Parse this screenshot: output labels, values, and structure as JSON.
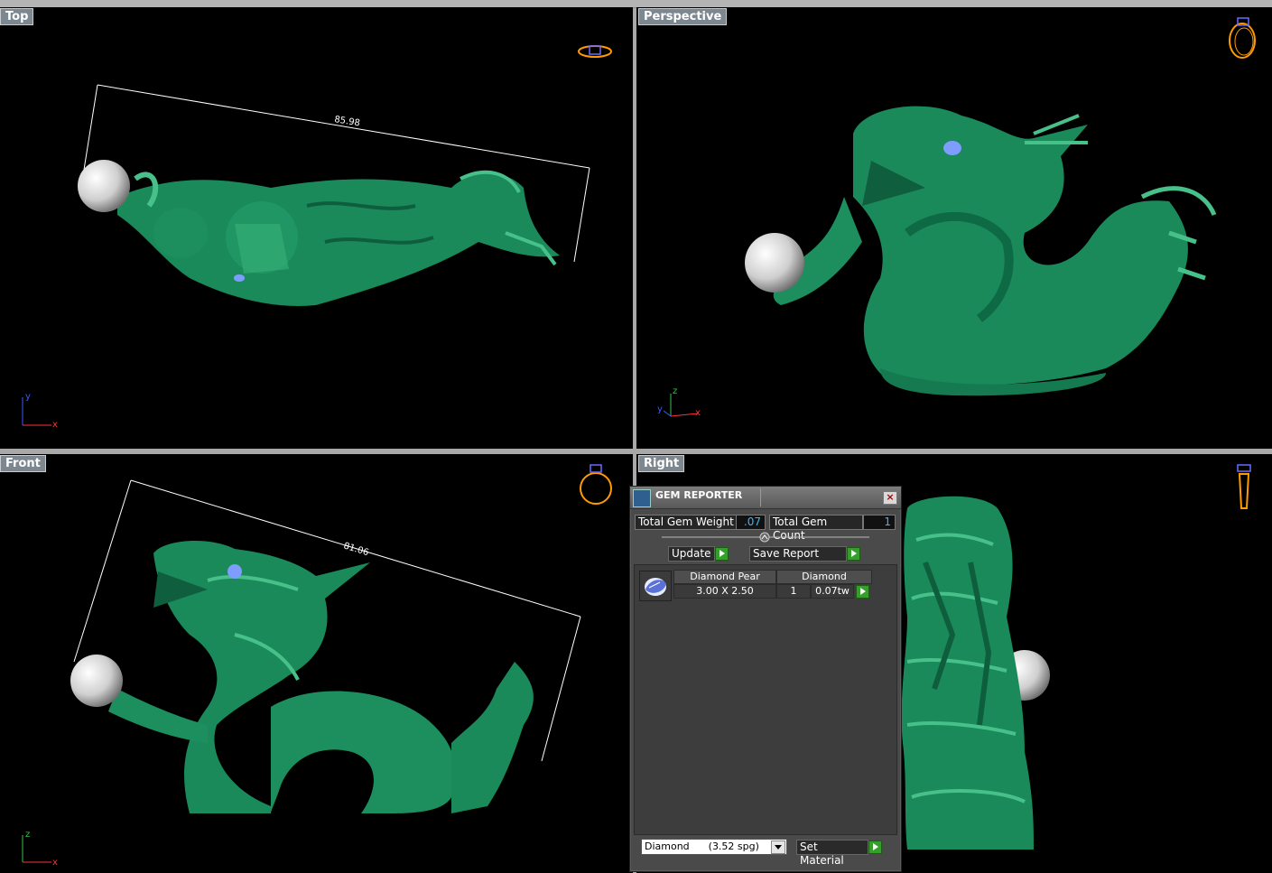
{
  "viewports": {
    "top": {
      "label": "Top",
      "dimension": "85.98",
      "axes": {
        "v": "y",
        "h": "x"
      }
    },
    "perspective": {
      "label": "Perspective",
      "axes": {
        "v": "z",
        "d": "y",
        "h": "x"
      }
    },
    "front": {
      "label": "Front",
      "dimension": "81.06",
      "axes": {
        "v": "z",
        "h": "x"
      }
    },
    "right": {
      "label": "Right"
    }
  },
  "colors": {
    "model_green": "#1a8a5a",
    "model_highlight": "#48c08a",
    "pearl": "#d8d8d8",
    "gem_blue": "#7f9cff",
    "viewport_bg": "#000000",
    "ring_icon": "#ff9a00",
    "field_value": "#37b7ff",
    "go_button": "#34a02a"
  },
  "gem_reporter": {
    "title": "GEM REPORTER",
    "total_weight_label": "Total Gem Weight",
    "total_weight_value": ".07",
    "total_count_label": "Total Gem Count",
    "total_count_value": "1",
    "update_label": "Update",
    "save_report_label": "Save Report",
    "table": {
      "header": [
        "Diamond Pear",
        "Diamond"
      ],
      "row": {
        "size": "3.00 X 2.50",
        "count": "1",
        "weight": "0.07tw"
      }
    },
    "material_select": "Diamond      (3.52 spg)",
    "set_material_label": "Set Material"
  },
  "icons": {
    "viewport_icon": "ring-icon",
    "title_icon": "gem-reporter-icon",
    "close": "close-icon",
    "go": "go-arrow-icon",
    "gem": "pear-gem-icon"
  }
}
